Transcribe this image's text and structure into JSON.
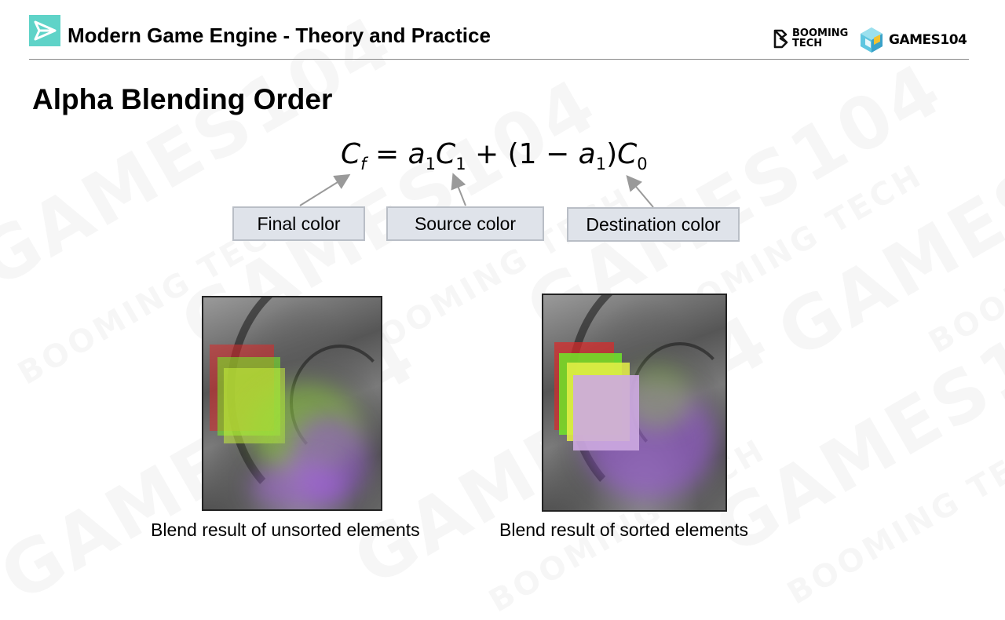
{
  "header": {
    "course_title": "Modern Game Engine - Theory and Practice",
    "logo_booming_line1": "BOOMING",
    "logo_booming_line2": "TECH",
    "logo_games": "GAMES104"
  },
  "slide": {
    "title": "Alpha Blending Order"
  },
  "formula": {
    "lhs": "C",
    "lhs_sub": "f",
    "eq": " = ",
    "a": "a",
    "a_sub": "1",
    "c1": "C",
    "c1_sub": "1",
    "plus": " + (1 − ",
    "a2": "a",
    "a2_sub": "1",
    "close": ")",
    "c0": "C",
    "c0_sub": "0"
  },
  "labels": {
    "final": "Final color",
    "source": "Source color",
    "destination": "Destination color"
  },
  "figures": {
    "left_caption": "Blend result of unsorted elements",
    "right_caption": "Blend result of sorted elements"
  },
  "watermark": {
    "text": "GAMES104",
    "small": "BOOMING TECH"
  },
  "colors": {
    "accent_teal": "#5fd3c8",
    "label_bg": "#dfe3ea",
    "label_border": "#b9bec6",
    "arrow": "#9a9a9a"
  }
}
